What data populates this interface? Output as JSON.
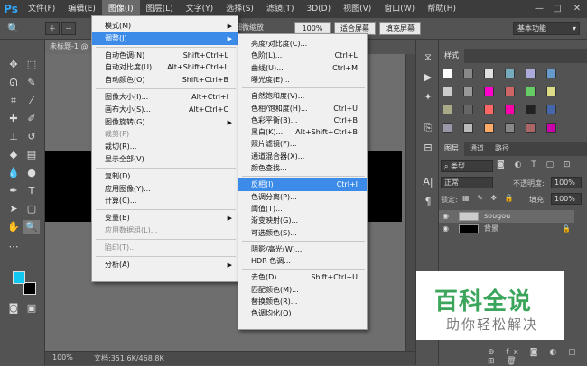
{
  "app": {
    "logo": "Ps"
  },
  "menubar": {
    "items": [
      "文件(F)",
      "编辑(E)",
      "图像(I)",
      "图层(L)",
      "文字(Y)",
      "选择(S)",
      "滤镜(T)",
      "3D(D)",
      "视图(V)",
      "窗口(W)",
      "帮助(H)"
    ],
    "active": "图像(I)",
    "minimize": "—",
    "restore": "□",
    "close": "✕"
  },
  "options": {
    "sample_label": "细微缩放",
    "zoom_value": "100%",
    "fit_screen": "适合屏幕",
    "fill_screen": "填充屏幕",
    "workspace": "基本功能"
  },
  "doc": {
    "tab_title": "未标题-1 @",
    "zoom": "100%",
    "status": "文档:351.6K/468.8K"
  },
  "image_menu": {
    "items": [
      {
        "label": "模式(M)",
        "submenu": true
      },
      {
        "label": "调整(J)",
        "submenu": true,
        "highlight": true
      },
      {
        "label": "自动色调(N)",
        "shortcut": "Shift+Ctrl+L"
      },
      {
        "label": "自动对比度(U)",
        "shortcut": "Alt+Shift+Ctrl+L"
      },
      {
        "label": "自动颜色(O)",
        "shortcut": "Shift+Ctrl+B"
      },
      {
        "label": "图像大小(I)...",
        "shortcut": "Alt+Ctrl+I"
      },
      {
        "label": "画布大小(S)...",
        "shortcut": "Alt+Ctrl+C"
      },
      {
        "label": "图像旋转(G)",
        "submenu": true
      },
      {
        "label": "裁剪(P)",
        "disabled": true
      },
      {
        "label": "裁切(R)..."
      },
      {
        "label": "显示全部(V)"
      },
      {
        "label": "复制(D)..."
      },
      {
        "label": "应用图像(Y)..."
      },
      {
        "label": "计算(C)..."
      },
      {
        "label": "变量(B)",
        "submenu": true
      },
      {
        "label": "应用数据组(L)...",
        "disabled": true
      },
      {
        "label": "陷印(T)...",
        "disabled": true
      },
      {
        "label": "分析(A)",
        "submenu": true
      }
    ]
  },
  "adjust_menu": {
    "items": [
      {
        "label": "亮度/对比度(C)..."
      },
      {
        "label": "色阶(L)...",
        "shortcut": "Ctrl+L"
      },
      {
        "label": "曲线(U)...",
        "shortcut": "Ctrl+M"
      },
      {
        "label": "曝光度(E)..."
      },
      {
        "label": "自然饱和度(V)..."
      },
      {
        "label": "色相/饱和度(H)...",
        "shortcut": "Ctrl+U"
      },
      {
        "label": "色彩平衡(B)...",
        "shortcut": "Ctrl+B"
      },
      {
        "label": "黑白(K)...",
        "shortcut": "Alt+Shift+Ctrl+B"
      },
      {
        "label": "照片滤镜(F)..."
      },
      {
        "label": "通道混合器(X)..."
      },
      {
        "label": "颜色查找..."
      },
      {
        "label": "反相(I)",
        "shortcut": "Ctrl+I",
        "highlight": true
      },
      {
        "label": "色调分离(P)..."
      },
      {
        "label": "阈值(T)..."
      },
      {
        "label": "渐变映射(G)..."
      },
      {
        "label": "可选颜色(S)..."
      },
      {
        "label": "阴影/高光(W)..."
      },
      {
        "label": "HDR 色调..."
      },
      {
        "label": "去色(D)",
        "shortcut": "Shift+Ctrl+U"
      },
      {
        "label": "匹配颜色(M)..."
      },
      {
        "label": "替换颜色(R)..."
      },
      {
        "label": "色调均化(Q)"
      }
    ]
  },
  "swatches_panel": {
    "tab": "样式"
  },
  "layers_panel": {
    "tabs": [
      "图层",
      "通道",
      "路径"
    ],
    "kind": "类型",
    "blend": "正常",
    "opacity_label": "不透明度:",
    "opacity": "100%",
    "lock_label": "锁定:",
    "fill_label": "填充:",
    "fill": "100%",
    "layers": [
      {
        "name": "sougou"
      },
      {
        "name": "背景"
      }
    ]
  },
  "watermark": {
    "title": "百科全说",
    "subtitle": "助你轻松解决"
  },
  "colors": {
    "fg": "#10c8f0",
    "bg": "#000000",
    "highlight": "#3c8be8"
  }
}
